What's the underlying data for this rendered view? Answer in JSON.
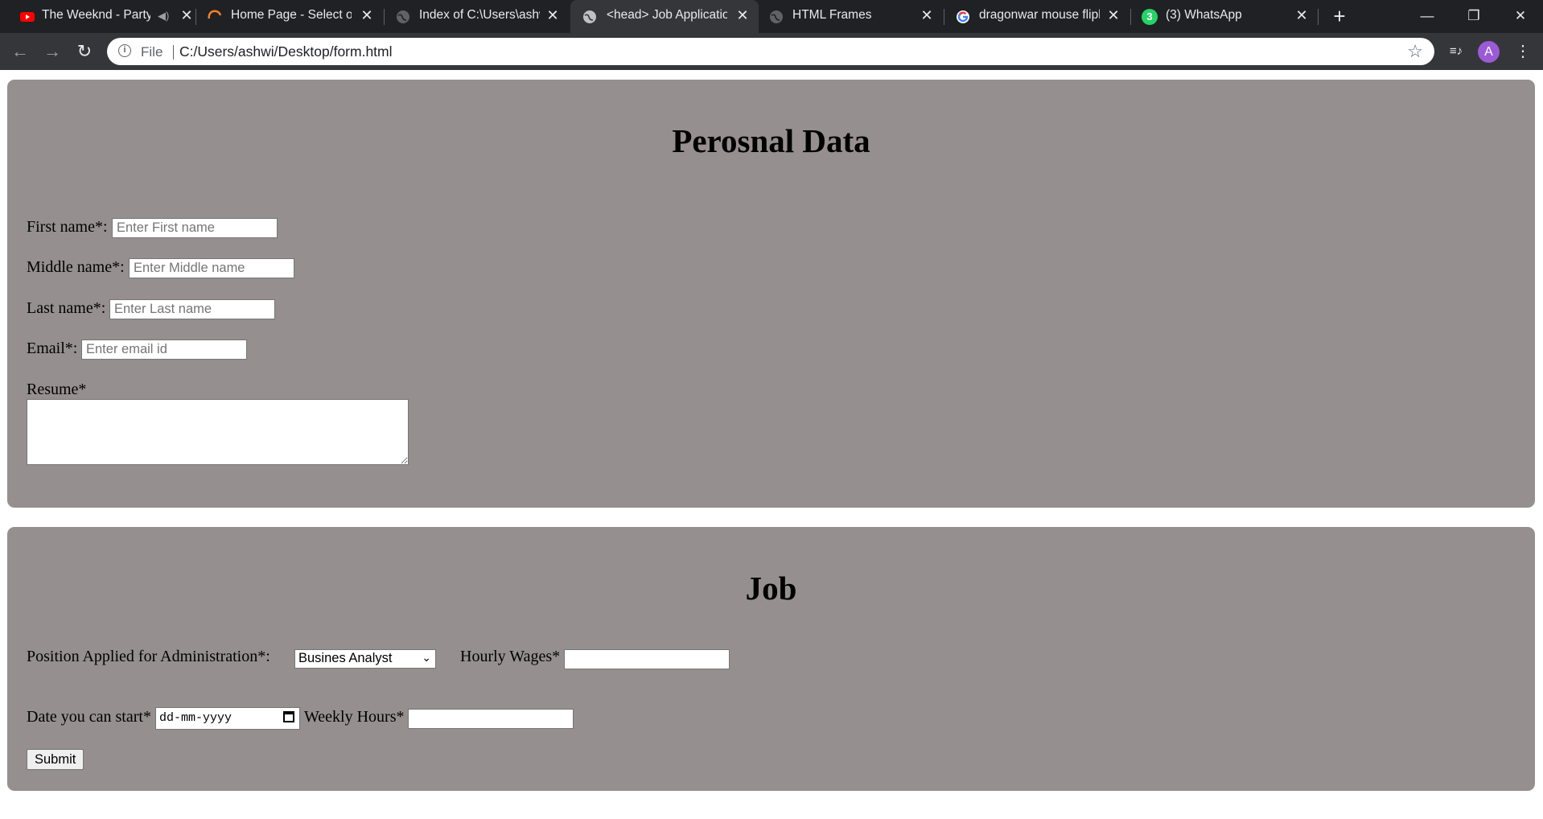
{
  "browser": {
    "tabs": [
      {
        "title": "The Weeknd - Party",
        "icon": "youtube-icon",
        "audio_icon": "speaker-muted-icon",
        "close": "✕"
      },
      {
        "title": "Home Page - Select or",
        "icon": "loading-spinner-icon",
        "close": "✕"
      },
      {
        "title": "Index of C:\\Users\\ashw",
        "icon": "globe-icon",
        "close": "✕"
      },
      {
        "title": "<head> Job Applicatio",
        "icon": "globe-icon",
        "close": "✕",
        "active": true
      },
      {
        "title": "HTML Frames",
        "icon": "globe-icon",
        "close": "✕"
      },
      {
        "title": "dragonwar mouse flipk",
        "icon": "google-icon",
        "close": "✕"
      },
      {
        "title": "(3) WhatsApp",
        "icon": "whatsapp-icon",
        "badge": "3",
        "close": "✕"
      }
    ],
    "new_tab": "+",
    "window_controls": {
      "minimize": "—",
      "restore": "❐",
      "close": "✕"
    },
    "nav": {
      "back": "←",
      "forward": "→",
      "reload": "↻"
    },
    "omnibox": {
      "info": "i",
      "scheme": "File",
      "url": "C:/Users/ashwi/Desktop/form.html",
      "star": "☆"
    },
    "toolbar_icons": {
      "media": "≡♪",
      "menu": "⋮"
    },
    "profile_initial": "A"
  },
  "personal": {
    "heading": "Perosnal Data",
    "first_name": {
      "label": "First name*:",
      "placeholder": "Enter First name"
    },
    "middle_name": {
      "label": "Middle name*:",
      "placeholder": "Enter Middle name"
    },
    "last_name": {
      "label": "Last name*:",
      "placeholder": "Enter Last name"
    },
    "email": {
      "label": "Email*:",
      "placeholder": "Enter email id"
    },
    "resume": {
      "label": "Resume*"
    }
  },
  "job": {
    "heading": "Job",
    "position": {
      "label": "Position Applied for Administration*:",
      "selected": "Busines Analyst"
    },
    "hourly_wages": {
      "label": "Hourly Wages*"
    },
    "start_date": {
      "label": "Date you can start*",
      "value": "dd-mm-yyyy"
    },
    "weekly_hours": {
      "label": "Weekly Hours*"
    },
    "submit": "Submit"
  },
  "colors": {
    "panel": "#968f8f",
    "tabbar": "#202124",
    "toolbar": "#35363a",
    "avatar": "#9c5bd6"
  }
}
